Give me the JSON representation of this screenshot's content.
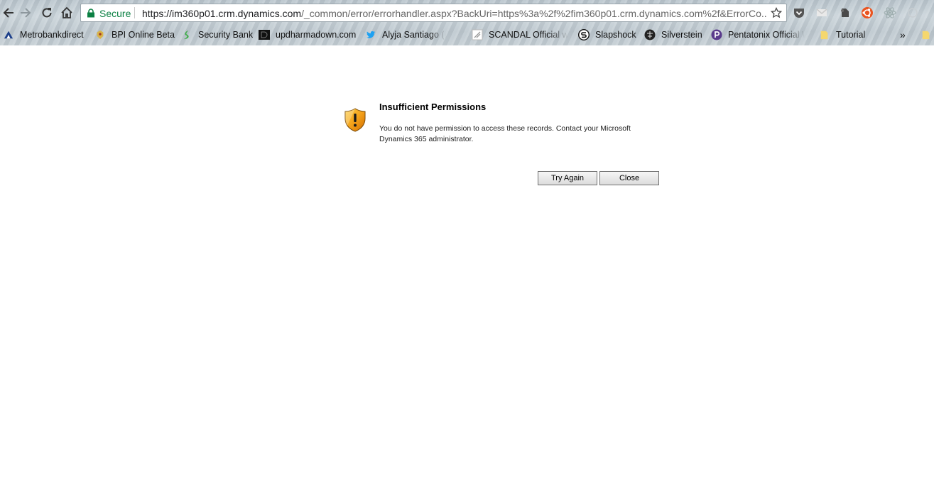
{
  "browser": {
    "secure_label": "Secure",
    "url_host": "https://im360p01.crm.dynamics.com",
    "url_rest": "/_common/error/errorhandler.aspx?BackUri=https%3a%2f%2fim360p01.crm.dynamics.com%2f&ErrorCo...",
    "colors": {
      "secure": "#0b8043"
    }
  },
  "bookmarks": [
    {
      "label": "Metrobankdirect",
      "icon": "metrobank-icon"
    },
    {
      "label": "BPI Online Beta",
      "icon": "bpi-icon"
    },
    {
      "label": "Security Bank",
      "icon": "security-bank-icon"
    },
    {
      "label": "updharmadown.com",
      "icon": "updharmadown-icon"
    },
    {
      "label": "Alyja Santiago (@aly",
      "icon": "twitter-icon"
    },
    {
      "label": "SCANDAL Official we",
      "icon": "scandal-icon"
    },
    {
      "label": "Slapshock",
      "icon": "slapshock-icon"
    },
    {
      "label": "Silverstein",
      "icon": "silverstein-icon"
    },
    {
      "label": "Pentatonix Official W",
      "icon": "pentatonix-icon"
    },
    {
      "label": "Tutorial",
      "icon": "folder-icon"
    }
  ],
  "bookmarks_overflow": "»",
  "error": {
    "title": "Insufficient Permissions",
    "message": "You do not have permission to access these records. Contact your Microsoft Dynamics 365 administrator.",
    "try_again_label": "Try Again",
    "close_label": "Close",
    "icon": "warning-shield-icon"
  }
}
